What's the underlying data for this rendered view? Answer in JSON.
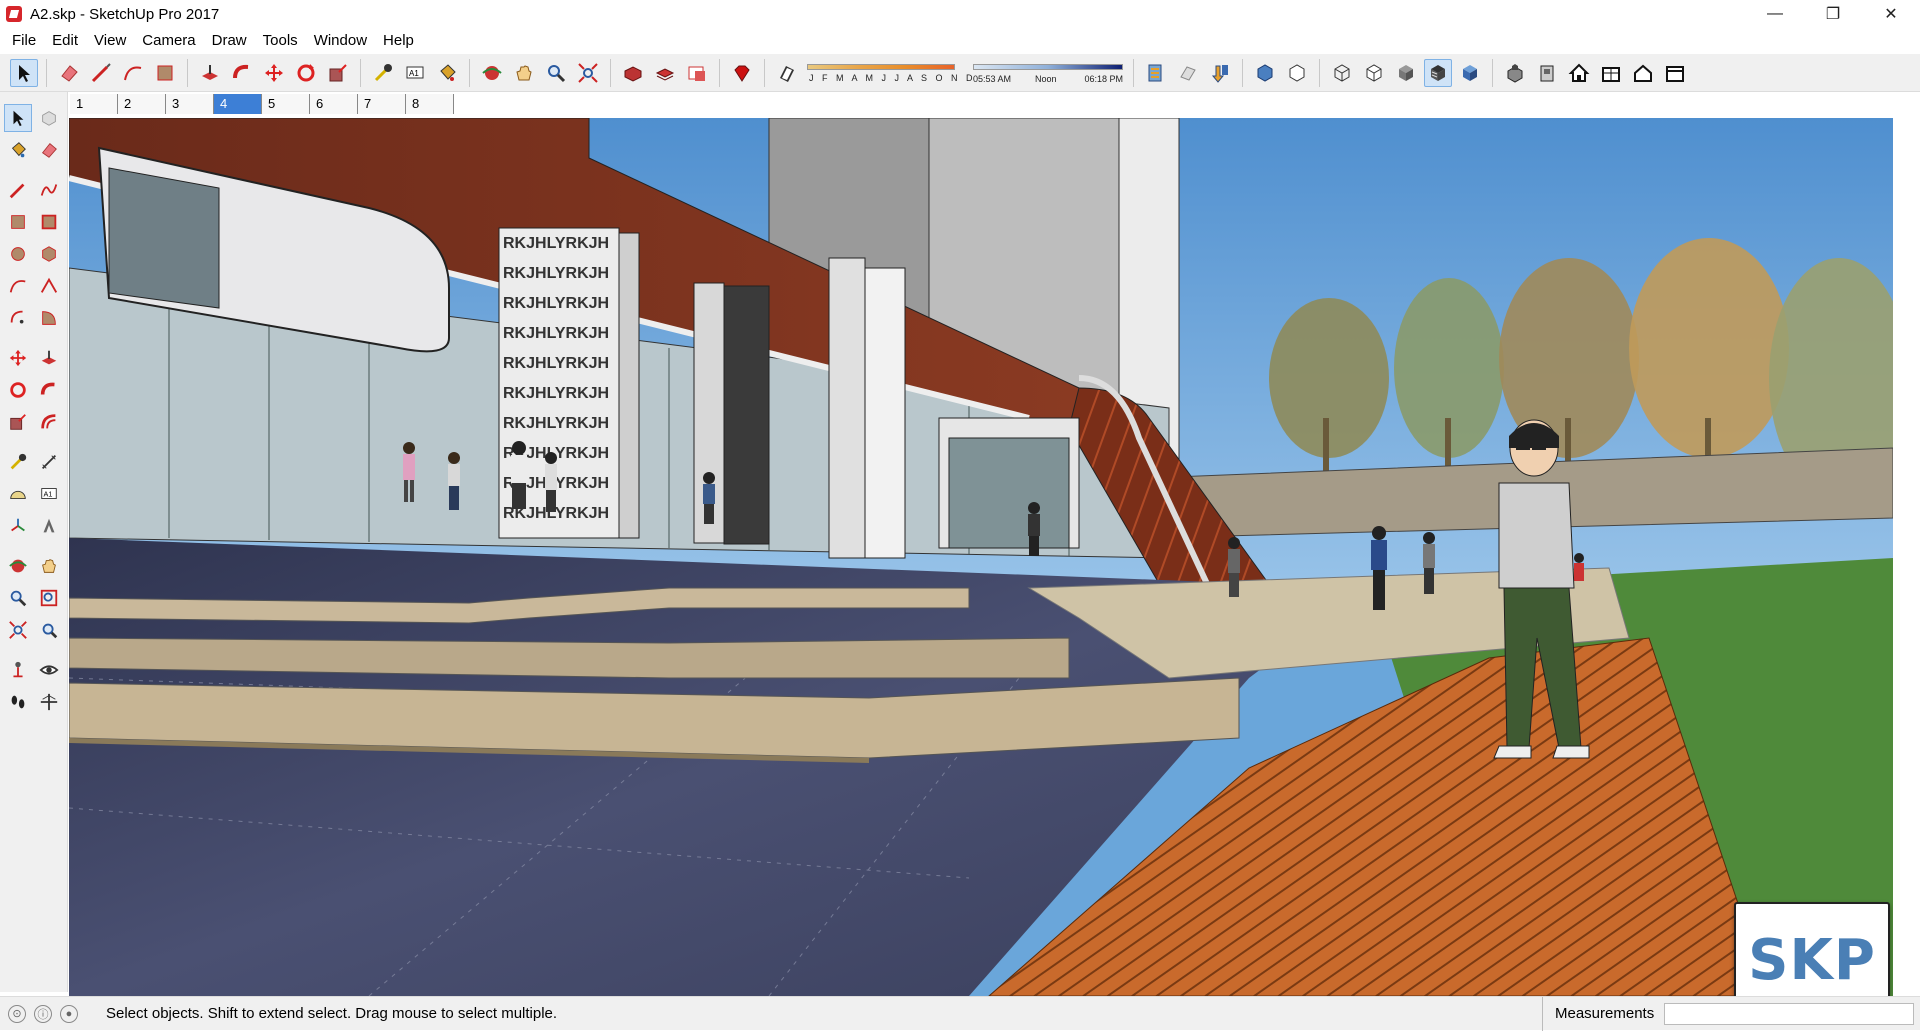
{
  "window": {
    "title": "A2.skp - SketchUp Pro 2017",
    "minimize_glyph": "—",
    "restore_glyph": "❐",
    "close_glyph": "✕"
  },
  "menu": {
    "items": [
      "File",
      "Edit",
      "View",
      "Camera",
      "Draw",
      "Tools",
      "Window",
      "Help"
    ]
  },
  "toolbar": {
    "tools": [
      "select",
      "eraser",
      "line",
      "arc",
      "rectangle",
      "push-pull",
      "follow-me",
      "move",
      "rotate",
      "scale",
      "tape-measure",
      "text",
      "paint-bucket",
      "orbit",
      "pan",
      "zoom",
      "zoom-extents",
      "3d-warehouse",
      "extension-warehouse",
      "model-info",
      "ruby-console",
      "shadows",
      "fog",
      "x-ray",
      "back-edges",
      "wireframe",
      "hidden-line",
      "shaded",
      "shaded-with-textures",
      "monochrome",
      "iso",
      "top",
      "front",
      "right",
      "back",
      "left"
    ],
    "shadows": {
      "months_label": "J F M A M J J A S O N D",
      "time_start": "05:53 AM",
      "time_mid": "Noon",
      "time_end": "06:18 PM"
    }
  },
  "scenes": {
    "tabs": [
      "1",
      "2",
      "3",
      "4",
      "5",
      "6",
      "7",
      "8"
    ],
    "active_index": 3
  },
  "left_tools": [
    "select",
    "component",
    "paint-bucket",
    "eraser",
    "line",
    "freehand",
    "rectangle",
    "rotated-rectangle",
    "circle",
    "polygon",
    "arc",
    "2-point-arc",
    "3-point-arc",
    "pie",
    "move",
    "push-pull",
    "rotate",
    "follow-me",
    "scale",
    "offset",
    "tape-measure",
    "dimension",
    "protractor",
    "text",
    "axes",
    "3d-text",
    "orbit",
    "pan",
    "zoom",
    "zoom-window",
    "zoom-extents",
    "previous",
    "position-camera",
    "look-around",
    "walk",
    "section-plane"
  ],
  "viewport": {
    "pillar_text": "RKJHLYRKJH",
    "colors": {
      "sky": "#6aa6da",
      "wood": "#c96a2c",
      "stone": "#3a3f5c",
      "grass": "#4f8a3a"
    }
  },
  "status": {
    "message": "Select objects. Shift to extend select. Drag mouse to select multiple.",
    "measurements_label": "Measurements"
  },
  "badge": {
    "text": "SKP"
  }
}
